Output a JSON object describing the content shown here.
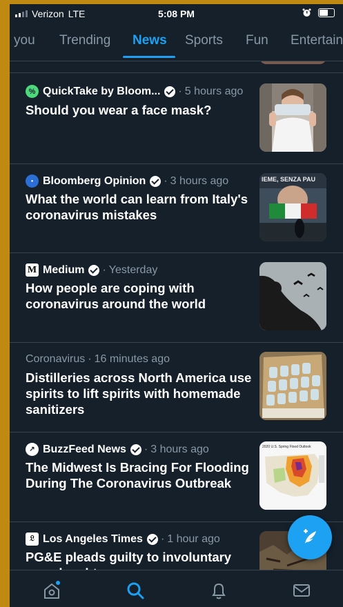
{
  "status_bar": {
    "carrier": "Verizon",
    "network": "LTE",
    "time": "5:08 PM"
  },
  "tabs": [
    {
      "label": "you"
    },
    {
      "label": "Trending"
    },
    {
      "label": "News"
    },
    {
      "label": "Sports"
    },
    {
      "label": "Fun"
    },
    {
      "label": "Entertainment"
    }
  ],
  "active_tab": "News",
  "feed": {
    "items": [
      {
        "source": "QuickTake by Bloom...",
        "verified": true,
        "time": "5 hours ago",
        "headline": "Should you wear a face mask?",
        "logo_color": "#4cd97b"
      },
      {
        "source": "Bloomberg Opinion",
        "verified": true,
        "time": "3 hours ago",
        "headline": "What the world can learn from Italy's coronavirus mistakes",
        "logo_color": "#2b6fd6",
        "thumb_text": "IEME, SENZA PAU"
      },
      {
        "source": "Medium",
        "verified": true,
        "time": "Yesterday",
        "headline": "How people are coping with coronavirus around the world",
        "logo_color": "#ffffff",
        "logo_text": "M"
      },
      {
        "topic": "Coronavirus",
        "time": "16 minutes ago",
        "headline": "Distilleries across North America use spirits to lift spirits with homemade sanitizers"
      },
      {
        "source": "BuzzFeed News",
        "verified": true,
        "time": "3 hours ago",
        "headline": "The Midwest Is Bracing For Flooding During The Coronavirus Outbreak",
        "logo_color": "#ffffff",
        "thumb_text": "2020 U.S. Spring Flood Outlook"
      },
      {
        "source": "Los Angeles Times",
        "verified": true,
        "time": "1 hour ago",
        "headline": "PG&E pleads guilty to involuntary manslaughter",
        "logo_color": "#ffffff"
      }
    ]
  },
  "colors": {
    "background": "#15202b",
    "accent": "#1da1f2",
    "muted": "#8899a6",
    "divider": "#38444d",
    "frame": "#c08a12"
  },
  "icons": {
    "compose": "compose-tweet-icon",
    "home": "home-icon",
    "search": "search-icon",
    "notifications": "bell-icon",
    "messages": "mail-icon"
  }
}
